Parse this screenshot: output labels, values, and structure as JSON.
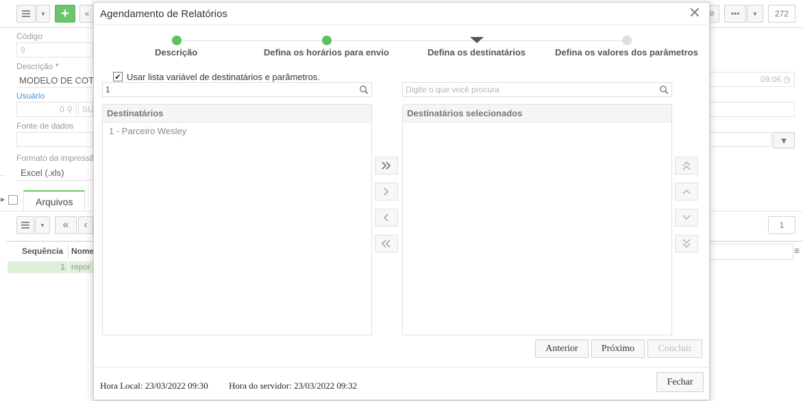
{
  "background": {
    "toolbar": {
      "record_count": "272"
    },
    "form": {
      "codigo_label": "Código",
      "codigo_value": "9",
      "descricao_label": "Descrição",
      "descricao_required": "*",
      "descricao_value": "MODELO DE COT",
      "time_value": "09:06",
      "usuario_label": "Usuário",
      "usuario_id": "0",
      "usuario_name": "SU",
      "fonte_label": "Fonte de dados",
      "formato_label": "Formato da impressã",
      "formato_value": "Excel (.xls)"
    },
    "tab_label": "Arquivos",
    "grid": {
      "page_value": "1",
      "columns": [
        "Sequência",
        "Nome"
      ],
      "rows": [
        {
          "seq": "1",
          "name": "repor"
        }
      ]
    }
  },
  "modal": {
    "title": "Agendamento de Relatórios",
    "steps": [
      {
        "label": "Descrição",
        "state": "done"
      },
      {
        "label": "Defina os horários para envio",
        "state": "done"
      },
      {
        "label": "Defina os destinatários",
        "state": "current"
      },
      {
        "label": "Defina os valores dos parâmetros",
        "state": "todo"
      }
    ],
    "checkbox_label": "Usar lista variável de destinatários e parâmetros.",
    "left_search_value": "1",
    "right_search_placeholder": "Digite o que você procura",
    "left_panel": {
      "header": "Destinatários",
      "items": [
        "1 - Parceiro Wesley"
      ]
    },
    "right_panel": {
      "header": "Destinatários selecionados",
      "items": []
    },
    "buttons": {
      "previous": "Anterior",
      "next": "Próximo",
      "finish": "Concluir",
      "close": "Fechar"
    },
    "footer": {
      "local_time": "Hora Local: 23/03/2022 09:30",
      "server_time": "Hora do servidor: 23/03/2022 09:32"
    },
    "colors": {
      "step_done": "#5cc45c",
      "step_todo": "#e0e0e0",
      "accent_green": "#6cc46c"
    },
    "icons": [
      "close-icon",
      "search-icon",
      "check-icon",
      "double-chevron-right-icon",
      "chevron-right-icon",
      "chevron-left-icon",
      "double-chevron-left-icon",
      "double-chevron-up-icon",
      "chevron-up-icon",
      "chevron-down-icon",
      "double-chevron-down-icon"
    ]
  }
}
